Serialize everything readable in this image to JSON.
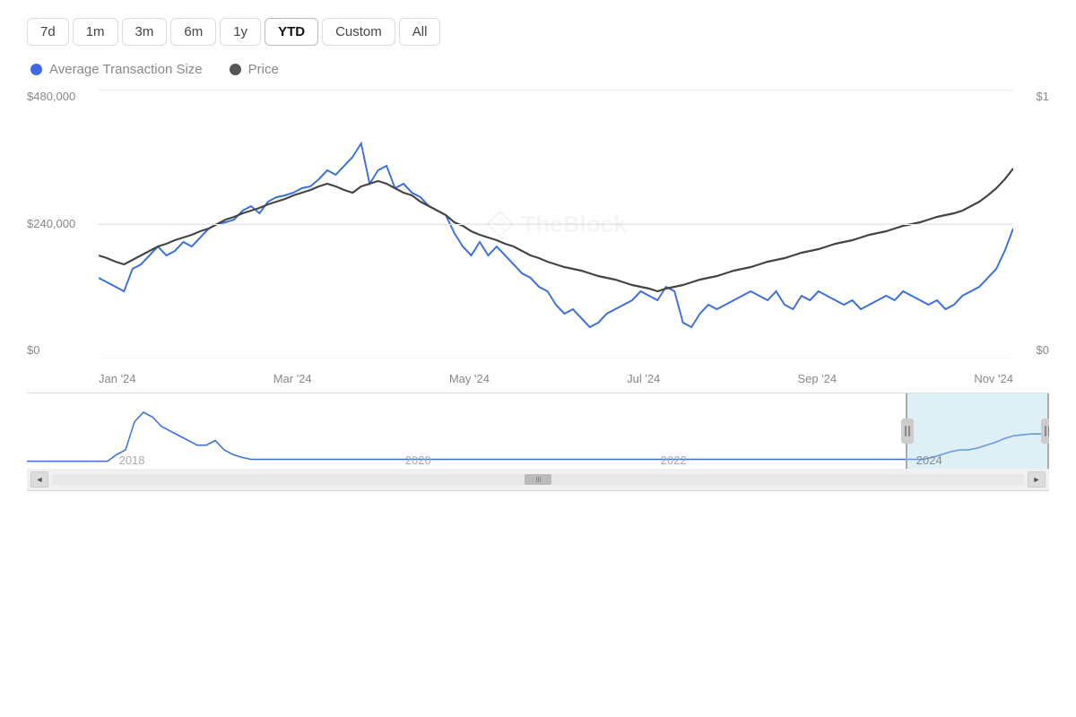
{
  "timeRange": {
    "buttons": [
      "7d",
      "1m",
      "3m",
      "6m",
      "1y",
      "YTD",
      "Custom",
      "All"
    ],
    "active": "YTD"
  },
  "legend": {
    "items": [
      {
        "id": "avg-tx-size",
        "label": "Average Transaction Size",
        "color": "blue"
      },
      {
        "id": "price",
        "label": "Price",
        "color": "dark"
      }
    ]
  },
  "mainChart": {
    "yAxisLeft": [
      "$480,000",
      "$240,000",
      "$0"
    ],
    "yAxisRight": [
      "$1",
      "",
      "$0"
    ],
    "xAxisLabels": [
      "Jan '24",
      "Mar '24",
      "May '24",
      "Jul '24",
      "Sep '24",
      "Nov '24"
    ],
    "watermark": "TheBlock"
  },
  "navigator": {
    "xAxisLabels": [
      "2018",
      "2020",
      "2022",
      "2024"
    ]
  },
  "scrollbar": {
    "leftArrow": "◄",
    "rightArrow": "►",
    "thumbLines": "|||"
  }
}
